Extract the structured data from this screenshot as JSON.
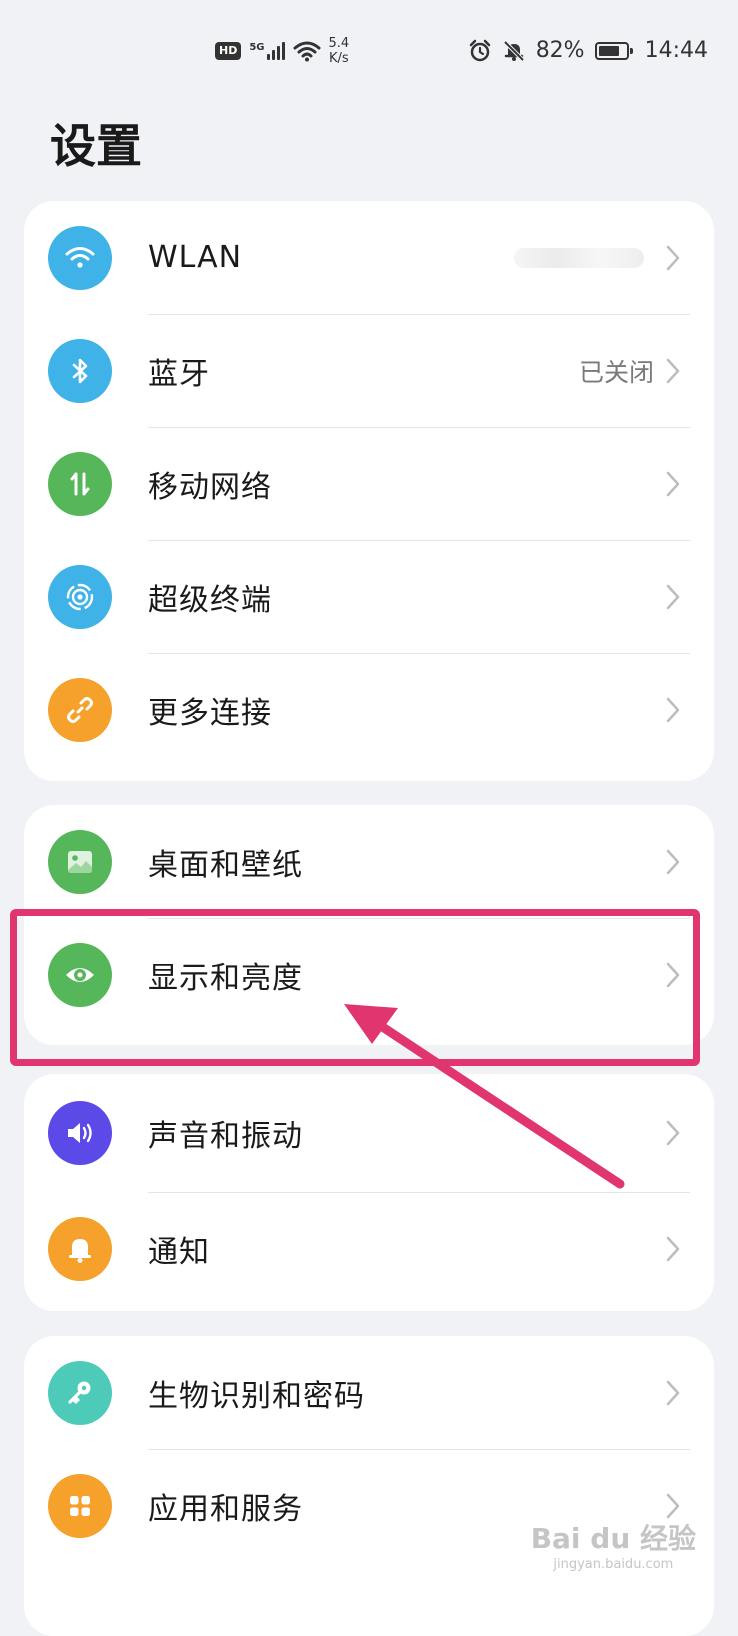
{
  "status_bar": {
    "hd": "HD",
    "network": "5G",
    "speed_value": "5.4",
    "speed_unit": "K/s",
    "battery_percent": "82%",
    "battery_level": 0.82,
    "time": "14:44"
  },
  "page": {
    "title": "设置"
  },
  "groups": [
    {
      "items": [
        {
          "label": "WLAN",
          "value": "",
          "icon": "wifi-icon",
          "color": "#3fb3e8"
        },
        {
          "label": "蓝牙",
          "value": "已关闭",
          "icon": "bluetooth-icon",
          "color": "#3fb3e8"
        },
        {
          "label": "移动网络",
          "value": "",
          "icon": "mobile-data-icon",
          "color": "#56b75a"
        },
        {
          "label": "超级终端",
          "value": "",
          "icon": "super-device-icon",
          "color": "#3fb3e8"
        },
        {
          "label": "更多连接",
          "value": "",
          "icon": "link-icon",
          "color": "#f5a12b"
        }
      ]
    },
    {
      "items": [
        {
          "label": "桌面和壁纸",
          "value": "",
          "icon": "wallpaper-icon",
          "color": "#56b75a"
        },
        {
          "label": "显示和亮度",
          "value": "",
          "icon": "eye-icon",
          "color": "#56b75a"
        }
      ]
    },
    {
      "items": [
        {
          "label": "声音和振动",
          "value": "",
          "icon": "speaker-icon",
          "color": "#5b4ae8"
        },
        {
          "label": "通知",
          "value": "",
          "icon": "bell-icon",
          "color": "#f5a12b"
        }
      ]
    },
    {
      "items": [
        {
          "label": "生物识别和密码",
          "value": "",
          "icon": "key-icon",
          "color": "#4dcbb8"
        },
        {
          "label": "应用和服务",
          "value": "",
          "icon": "apps-grid-icon",
          "color": "#f5a12b"
        }
      ]
    }
  ],
  "annotation": {
    "color": "#e0356f"
  },
  "watermark": {
    "brand": "Bai du 经验",
    "url": "jingyan.baidu.com"
  }
}
